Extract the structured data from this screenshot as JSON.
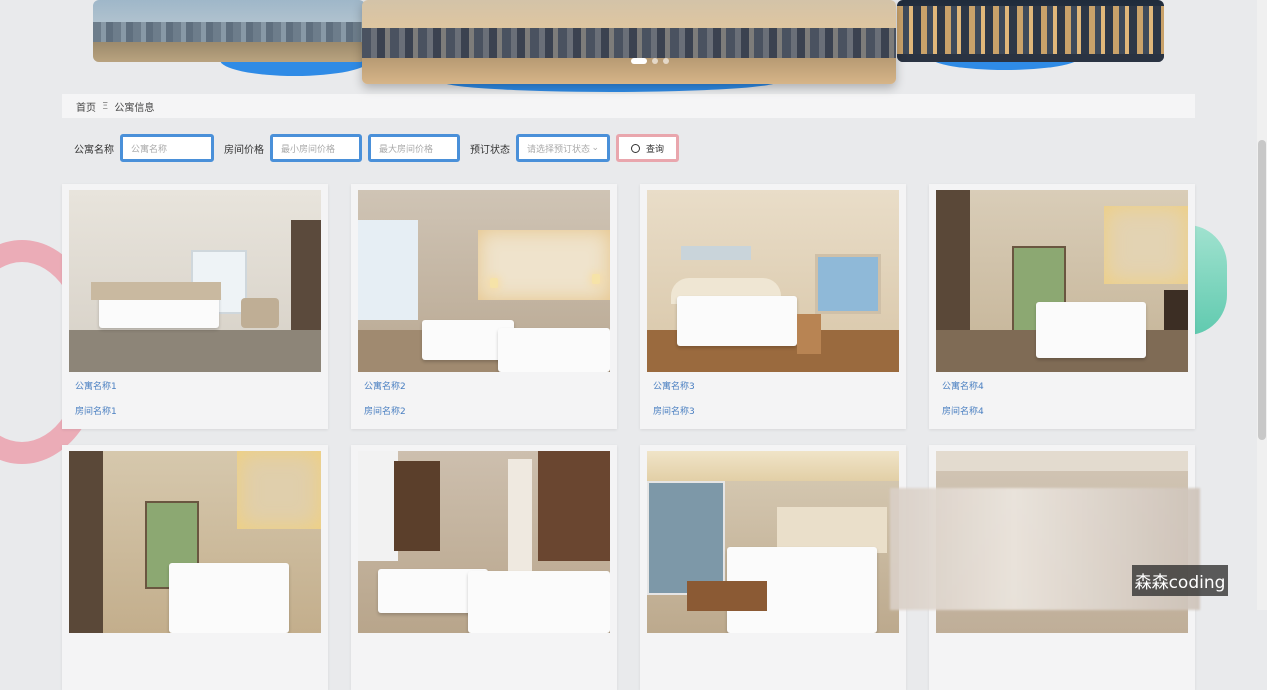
{
  "breadcrumb": {
    "home": "首页",
    "separator": "Ξ",
    "current": "公寓信息"
  },
  "search": {
    "name_label": "公寓名称",
    "name_placeholder": "公寓名称",
    "price_label": "房间价格",
    "min_price_placeholder": "最小房间价格",
    "max_price_placeholder": "最大房间价格",
    "status_label": "预订状态",
    "status_placeholder": "请选择预订状态",
    "search_button": "查询"
  },
  "carousel": {
    "slide_count": 3,
    "active_index": 0
  },
  "cards": [
    {
      "apartment": "公寓名称1",
      "room": "房间名称1"
    },
    {
      "apartment": "公寓名称2",
      "room": "房间名称2"
    },
    {
      "apartment": "公寓名称3",
      "room": "房间名称3"
    },
    {
      "apartment": "公寓名称4",
      "room": "房间名称4"
    },
    {
      "apartment": "",
      "room": ""
    },
    {
      "apartment": "",
      "room": ""
    },
    {
      "apartment": "",
      "room": ""
    },
    {
      "apartment": "",
      "room": ""
    }
  ],
  "watermark": "森森coding",
  "colors": {
    "accent_blue": "#4a90d9",
    "link_blue": "#4a7fc1",
    "button_border": "#e9a6ad"
  }
}
